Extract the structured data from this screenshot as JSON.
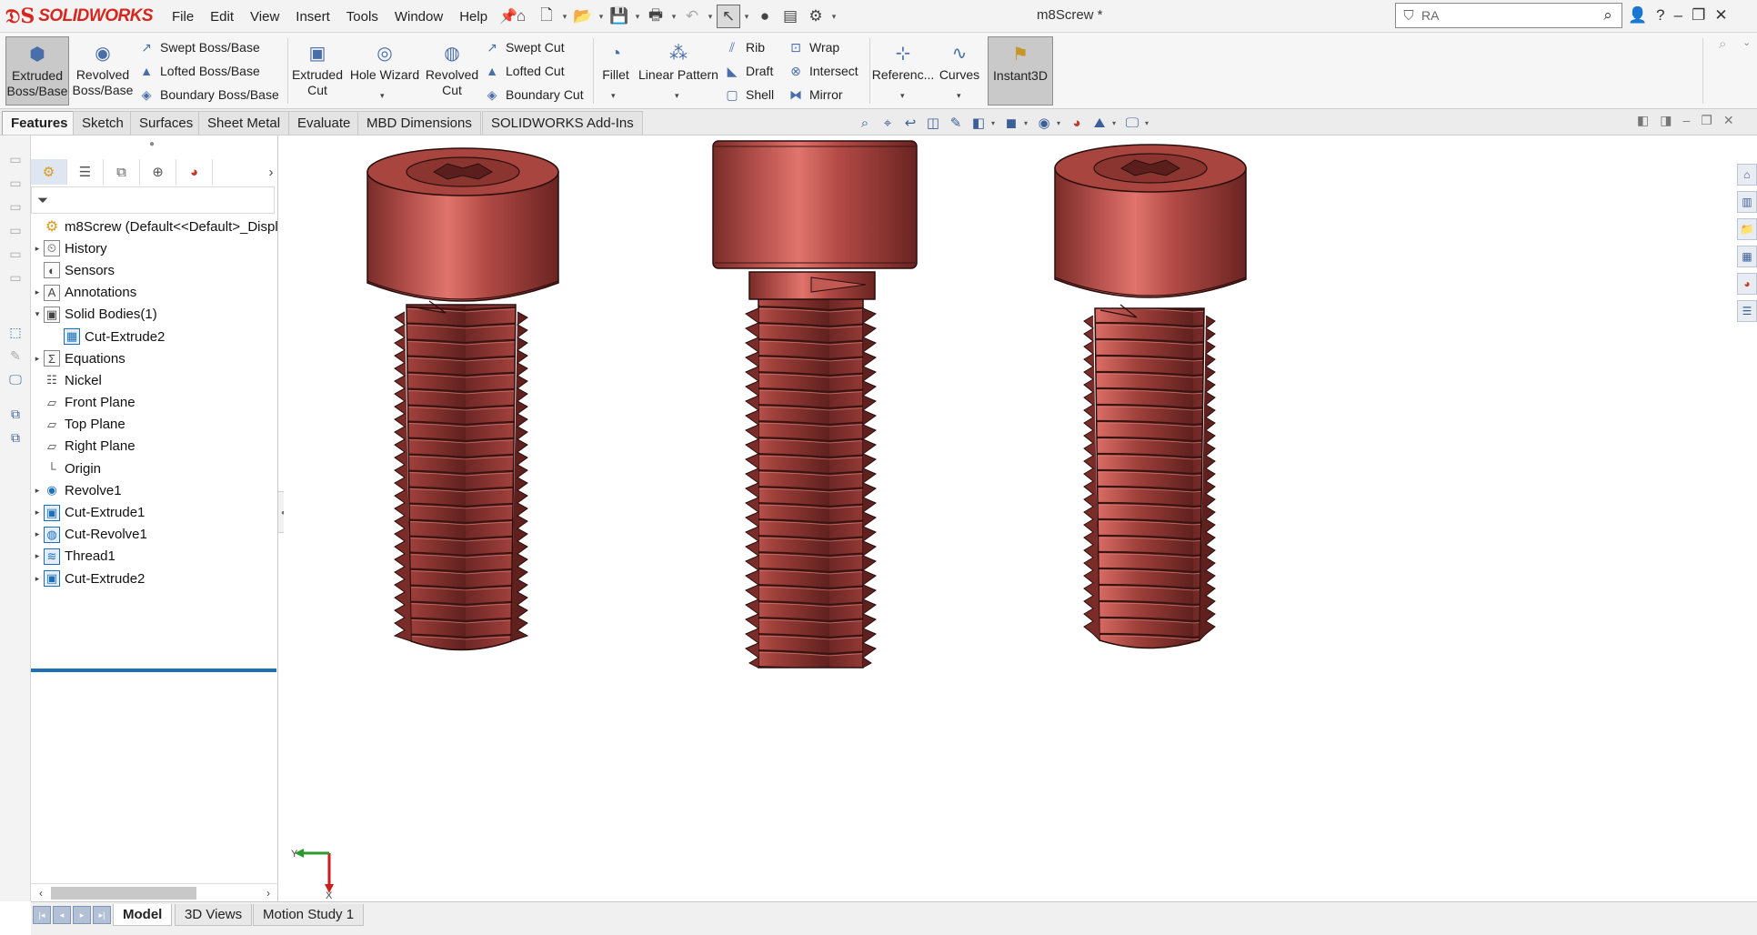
{
  "app": {
    "brand": "SOLIDWORKS",
    "doc_title": "m8Screw *"
  },
  "menu": [
    "File",
    "Edit",
    "View",
    "Insert",
    "Tools",
    "Window",
    "Help"
  ],
  "search": {
    "value": "RA"
  },
  "ribbon": {
    "extruded_boss": "Extruded Boss/Base",
    "revolved_boss": "Revolved Boss/Base",
    "swept_boss": "Swept Boss/Base",
    "lofted_boss": "Lofted Boss/Base",
    "boundary_boss": "Boundary Boss/Base",
    "extruded_cut": "Extruded Cut",
    "hole_wizard": "Hole Wizard",
    "revolved_cut": "Revolved Cut",
    "swept_cut": "Swept Cut",
    "lofted_cut": "Lofted Cut",
    "boundary_cut": "Boundary Cut",
    "fillet": "Fillet",
    "linear_pattern": "Linear Pattern",
    "rib": "Rib",
    "draft": "Draft",
    "shell": "Shell",
    "wrap": "Wrap",
    "intersect": "Intersect",
    "mirror": "Mirror",
    "reference": "Referenc...",
    "curves": "Curves",
    "instant3d": "Instant3D"
  },
  "cm_tabs": [
    "Features",
    "Sketch",
    "Surfaces",
    "Sheet Metal",
    "Evaluate",
    "MBD Dimensions",
    "SOLIDWORKS Add-Ins"
  ],
  "tree": {
    "root": "m8Screw  (Default<<Default>_Displ",
    "nodes": [
      "History",
      "Sensors",
      "Annotations",
      "Solid Bodies(1)",
      "Cut-Extrude2",
      "Equations",
      "Nickel",
      "Front Plane",
      "Top Plane",
      "Right Plane",
      "Origin",
      "Revolve1",
      "Cut-Extrude1",
      "Cut-Revolve1",
      "Thread1",
      "Cut-Extrude2"
    ]
  },
  "triad": {
    "y": "Y",
    "x": "X"
  },
  "bottom_tabs": [
    "Model",
    "3D Views",
    "Motion Study 1"
  ],
  "colors": {
    "brand": "#d7261e",
    "screw": "#a4433f",
    "accent": "#1f6fb5"
  }
}
